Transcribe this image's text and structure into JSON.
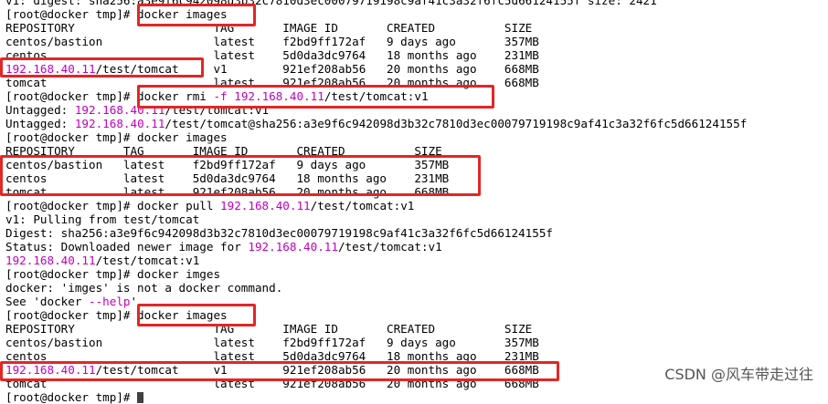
{
  "app": "terminal",
  "accent_colors": {
    "ip": "#c000c0",
    "highlight_box": "#e32626"
  },
  "lines": [
    "v1: digest: sha256:a3e9f6c942098d3b32c7810d3ec00079719198c9af41c3a32f6fc5d66124155f size: 2421",
    "[root@docker tmp]# docker images",
    "REPOSITORY                    TAG       IMAGE ID       CREATED          SIZE",
    "centos/bastion                latest    f2bd9ff172af   9 days ago       357MB",
    "centos                        latest    5d0da3dc9764   18 months ago    231MB",
    "192.168.40.11/test/tomcat     v1        921ef208ab56   20 months ago    668MB",
    "tomcat                        latest    921ef208ab56   20 months ago    668MB",
    "[root@docker tmp]# docker rmi -f 192.168.40.11/test/tomcat:v1",
    "Untagged: 192.168.40.11/test/tomcat:v1",
    "Untagged: 192.168.40.11/test/tomcat@sha256:a3e9f6c942098d3b32c7810d3ec00079719198c9af41c3a32f6fc5d66124155f",
    "[root@docker tmp]# docker images",
    "REPOSITORY       TAG       IMAGE ID       CREATED          SIZE",
    "centos/bastion   latest    f2bd9ff172af   9 days ago       357MB",
    "centos           latest    5d0da3dc9764   18 months ago    231MB",
    "tomcat           latest    921ef208ab56   20 months ago    668MB",
    "[root@docker tmp]# docker pull 192.168.40.11/test/tomcat:v1",
    "v1: Pulling from test/tomcat",
    "Digest: sha256:a3e9f6c942098d3b32c7810d3ec00079719198c9af41c3a32f6fc5d66124155f",
    "Status: Downloaded newer image for 192.168.40.11/test/tomcat:v1",
    "192.168.40.11/test/tomcat:v1",
    "[root@docker tmp]# docker imges",
    "docker: 'imges' is not a docker command.",
    "See 'docker --help'",
    "[root@docker tmp]# docker images",
    "REPOSITORY                    TAG       IMAGE ID       CREATED          SIZE",
    "centos/bastion                latest    f2bd9ff172af   9 days ago       357MB",
    "centos                        latest    5d0da3dc9764   18 months ago    231MB",
    "192.168.40.11/test/tomcat     v1        921ef208ab56   20 months ago    668MB",
    "tomcat                        latest    921ef208ab56   20 months ago    668MB",
    "[root@docker tmp]# "
  ],
  "watermark": "CSDN @风车带走过往"
}
